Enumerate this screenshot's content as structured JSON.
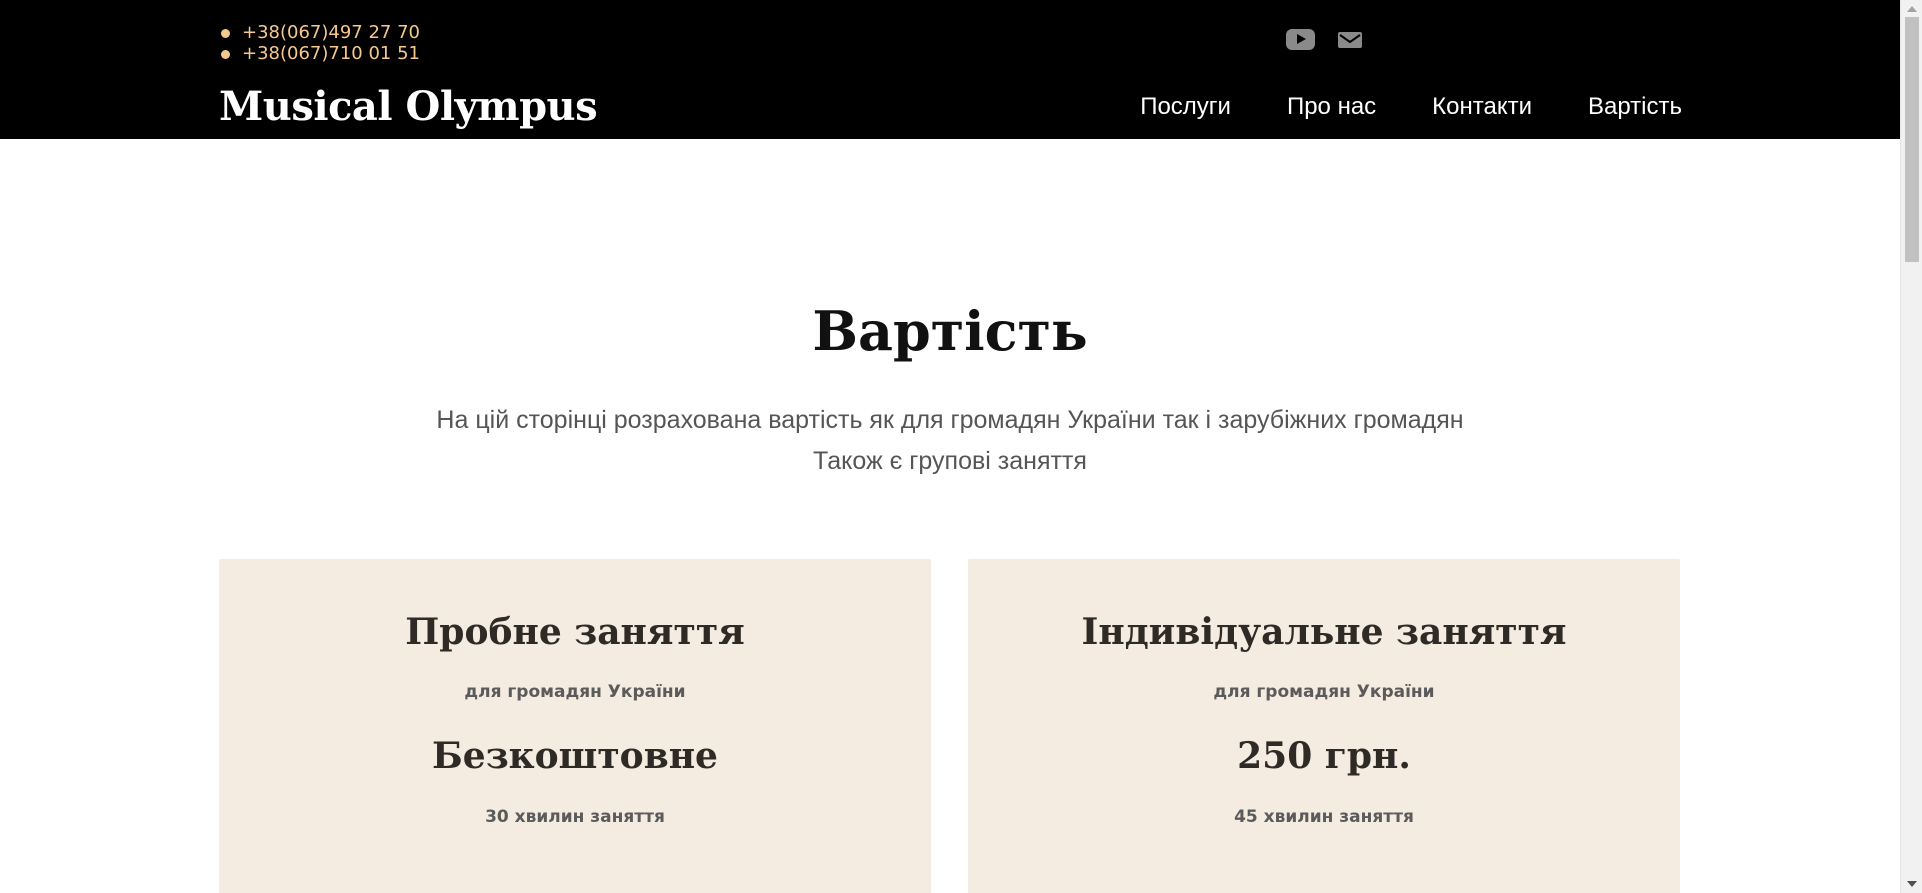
{
  "header": {
    "phones": [
      "+38(067)497 27 70",
      "+38(067)710 01 51"
    ],
    "social_icons": [
      "youtube-icon",
      "mail-icon"
    ],
    "logo": "Musical Olympus",
    "nav": [
      "Послуги",
      "Про нас",
      "Контакти",
      "Вартість"
    ]
  },
  "main": {
    "title": "Вартість",
    "subtitle_lines": [
      "На цій сторінці розрахована вартість як для громадян України так і зарубіжних громадян",
      "Також є групові заняття"
    ],
    "cards": [
      {
        "title": "Пробне заняття",
        "note": "для громадян України",
        "price": "Безкоштовне",
        "duration": "30 хвилин заняття"
      },
      {
        "title": "Індивідуальне заняття",
        "note": "для громадян України",
        "price": "250 грн.",
        "duration": "45 хвилин заняття"
      }
    ]
  },
  "colors": {
    "header_bg": "#000000",
    "phone_accent": "#f6c88e",
    "card_bg": "#f4ebe1",
    "heading": "#111111",
    "muted_text": "#555555"
  }
}
